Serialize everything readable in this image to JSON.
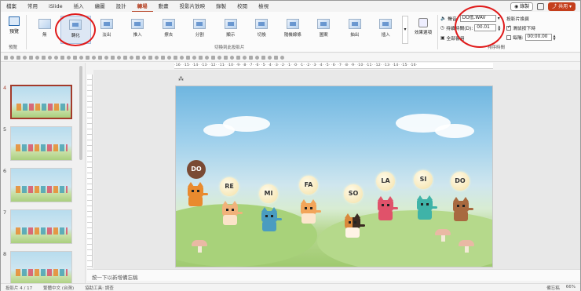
{
  "menu": {
    "tabs": [
      "檔案",
      "常用",
      "iSlide",
      "插入",
      "繪圖",
      "設計",
      "轉場",
      "動畫",
      "投影片放映",
      "錄製",
      "校閱",
      "檢視"
    ],
    "active_index": 6,
    "record_label": "錄製",
    "share_label": "共用"
  },
  "ribbon": {
    "preview_label": "預覽",
    "preview_group": "預覽",
    "transitions": [
      "無",
      "轉化",
      "淡出",
      "推入",
      "擦去",
      "分割",
      "顯示",
      "切換",
      "隨機線條",
      "圖案",
      "抽出",
      "插入"
    ],
    "selected_transition": 1,
    "gallery_group": "切換到此投影片",
    "effect_options_label": "效果選項",
    "timing": {
      "sound_label": "聲音:",
      "sound_value": "DO低.WAV",
      "duration_label": "持續時間(D):",
      "duration_value": "00.01",
      "apply_all_label": "全部套用",
      "advance_title": "投影片換頁",
      "on_click_label": "滑鼠按下時",
      "on_click_checked": true,
      "after_label": "每隔:",
      "after_checked": false,
      "after_value": "00:00.00",
      "group_label": "排序時間"
    }
  },
  "thumbnails": {
    "numbers": [
      "4",
      "5",
      "6",
      "7",
      "8"
    ],
    "selected": "4"
  },
  "ruler_text": "·16·  ·15·  ·14·  ·13·  ·12·  ·11·  ·10·  ·9·  ·8·  ·7·  ·6·  ·5·  ·4·  ·3·  ·2·  ·1·  ·0·  ·1·  ·2·  ·3·  ·4·  ·5·  ·6·  ·7·  ·8·  ·9·  ·10·  ·11·  ·12·  ·13·  ·14·  ·15·  ·16·",
  "slide": {
    "notes": [
      "DO",
      "RE",
      "MI",
      "FA",
      "SO",
      "LA",
      "SI",
      "DO"
    ],
    "cat_colors": [
      "#e98a2e",
      "#f0b27a",
      "#4a9cc0",
      "#f2a55a",
      "#d9883c",
      "#e0526a",
      "#3fb3a8",
      "#a8693f"
    ]
  },
  "notes_placeholder": "按一下以新增備忘稿",
  "status": {
    "slide_info": "投影片 4 / 17",
    "language": "繁體中文 (台灣)",
    "accessibility": "協助工具: 調查",
    "notes_label": "備忘稿",
    "zoom": "66%"
  }
}
